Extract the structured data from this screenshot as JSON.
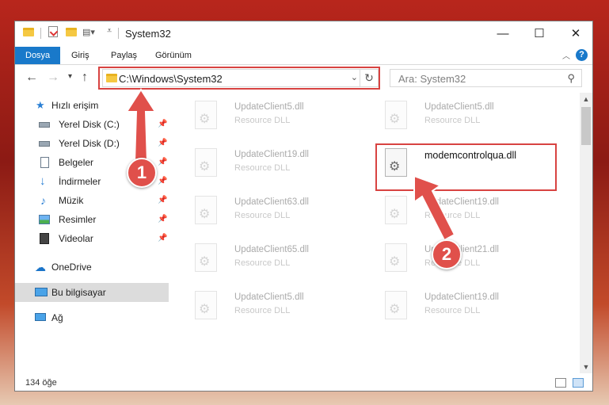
{
  "window": {
    "title": "System32",
    "controls": {
      "minimize": "—",
      "maximize": "☐",
      "close": "✕"
    }
  },
  "ribbon": {
    "tabs": [
      {
        "label": "Dosya",
        "active": true
      },
      {
        "label": "Giriş"
      },
      {
        "label": "Paylaş"
      },
      {
        "label": "Görünüm"
      }
    ],
    "help": "?"
  },
  "navigation": {
    "address": "C:\\Windows\\System32",
    "search_placeholder": "Ara: System32"
  },
  "sidebar": {
    "items": [
      {
        "label": "Hızlı erişim",
        "icon": "star-icon"
      },
      {
        "label": "Yerel Disk (C:)",
        "icon": "drive-icon",
        "pinned": true
      },
      {
        "label": "Yerel Disk (D:)",
        "icon": "drive-icon",
        "pinned": true
      },
      {
        "label": "Belgeler",
        "icon": "document-icon",
        "pinned": true
      },
      {
        "label": "İndirmeler",
        "icon": "download-icon",
        "pinned": true
      },
      {
        "label": "Müzik",
        "icon": "music-icon",
        "pinned": true
      },
      {
        "label": "Resimler",
        "icon": "pictures-icon",
        "pinned": true
      },
      {
        "label": "Videolar",
        "icon": "video-icon",
        "pinned": true
      },
      {
        "label": "OneDrive",
        "icon": "cloud-icon"
      },
      {
        "label": "Bu bilgisayar",
        "icon": "computer-icon",
        "selected": true
      },
      {
        "label": "Ağ",
        "icon": "network-icon"
      }
    ]
  },
  "files": [
    {
      "name": "UpdateClient5.dll",
      "type": "Resource DLL"
    },
    {
      "name": "UpdateClient5.dll",
      "type": "Resource DLL"
    },
    {
      "name": "UpdateClient19.dll",
      "type": "Resource DLL"
    },
    {
      "name": "modemcontrolqua.dll",
      "type": "",
      "highlighted": true
    },
    {
      "name": "UpdateClient63.dll",
      "type": "Resource DLL"
    },
    {
      "name": "UpdateClient19.dll",
      "type": "Resource DLL"
    },
    {
      "name": "UpdateClient65.dll",
      "type": "Resource DLL"
    },
    {
      "name": "UpdateClient21.dll",
      "type": "Resource DLL"
    },
    {
      "name": "UpdateClient5.dll",
      "type": "Resource DLL"
    },
    {
      "name": "UpdateClient19.dll",
      "type": "Resource DLL"
    }
  ],
  "status": {
    "count": "134 öğe"
  },
  "annotations": {
    "step1": "1",
    "step2": "2",
    "color": "#d84341"
  }
}
